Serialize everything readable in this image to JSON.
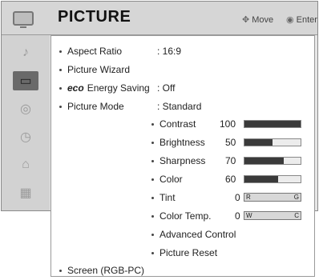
{
  "header": {
    "title": "PICTURE",
    "move_label": "Move",
    "enter_label": "Enter"
  },
  "sidebar": {
    "items": [
      {
        "icon": "speaker-icon",
        "active": false
      },
      {
        "icon": "picture-icon",
        "active": true
      },
      {
        "icon": "audio-icon",
        "active": false
      },
      {
        "icon": "clock-icon",
        "active": false
      },
      {
        "icon": "lock-icon",
        "active": false
      },
      {
        "icon": "option-icon",
        "active": false
      }
    ]
  },
  "menu": {
    "aspect_ratio": {
      "label": "Aspect Ratio",
      "value": ": 16:9"
    },
    "picture_wizard": {
      "label": "Picture Wizard"
    },
    "energy_saving": {
      "label": "Energy Saving",
      "value": ": Off"
    },
    "picture_mode": {
      "label": "Picture Mode",
      "value": ": Standard"
    },
    "contrast": {
      "label": "Contrast",
      "value": "100",
      "level": 1.0
    },
    "brightness": {
      "label": "Brightness",
      "value": "50",
      "level": 0.5
    },
    "sharpness": {
      "label": "Sharpness",
      "value": "70",
      "level": 0.7
    },
    "color": {
      "label": "Color",
      "value": "60",
      "level": 0.6
    },
    "tint": {
      "label": "Tint",
      "value": "0",
      "left": "R",
      "right": "G"
    },
    "color_temp": {
      "label": "Color Temp.",
      "value": "0",
      "left": "W",
      "right": "C"
    },
    "advanced_control": {
      "label": "Advanced Control"
    },
    "picture_reset": {
      "label": "Picture Reset"
    },
    "screen": {
      "label": "Screen (RGB-PC)"
    }
  }
}
